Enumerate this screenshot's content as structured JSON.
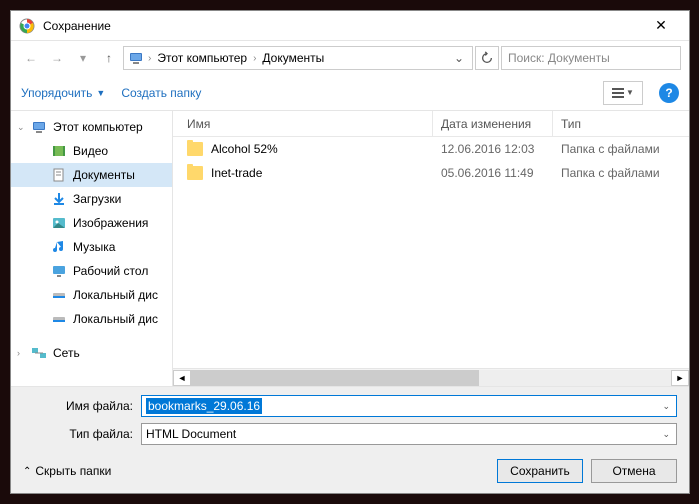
{
  "title": "Сохранение",
  "breadcrumb": {
    "item1": "Этот компьютер",
    "item2": "Документы"
  },
  "search": {
    "placeholder": "Поиск: Документы"
  },
  "toolbar": {
    "organize": "Упорядочить",
    "newFolder": "Создать папку"
  },
  "sidebar": {
    "root": "Этот компьютер",
    "items": [
      "Видео",
      "Документы",
      "Загрузки",
      "Изображения",
      "Музыка",
      "Рабочий стол",
      "Локальный дис",
      "Локальный дис"
    ],
    "network": "Сеть"
  },
  "columns": {
    "name": "Имя",
    "date": "Дата изменения",
    "type": "Тип"
  },
  "files": [
    {
      "name": "Alcohol 52%",
      "date": "12.06.2016 12:03",
      "type": "Папка с файлами"
    },
    {
      "name": "Inet-trade",
      "date": "05.06.2016 11:49",
      "type": "Папка с файлами"
    }
  ],
  "form": {
    "filenameLabel": "Имя файла:",
    "filenameValue": "bookmarks_29.06.16",
    "filetypeLabel": "Тип файла:",
    "filetypeValue": "HTML Document"
  },
  "footer": {
    "hideFolders": "Скрыть папки",
    "save": "Сохранить",
    "cancel": "Отмена"
  }
}
